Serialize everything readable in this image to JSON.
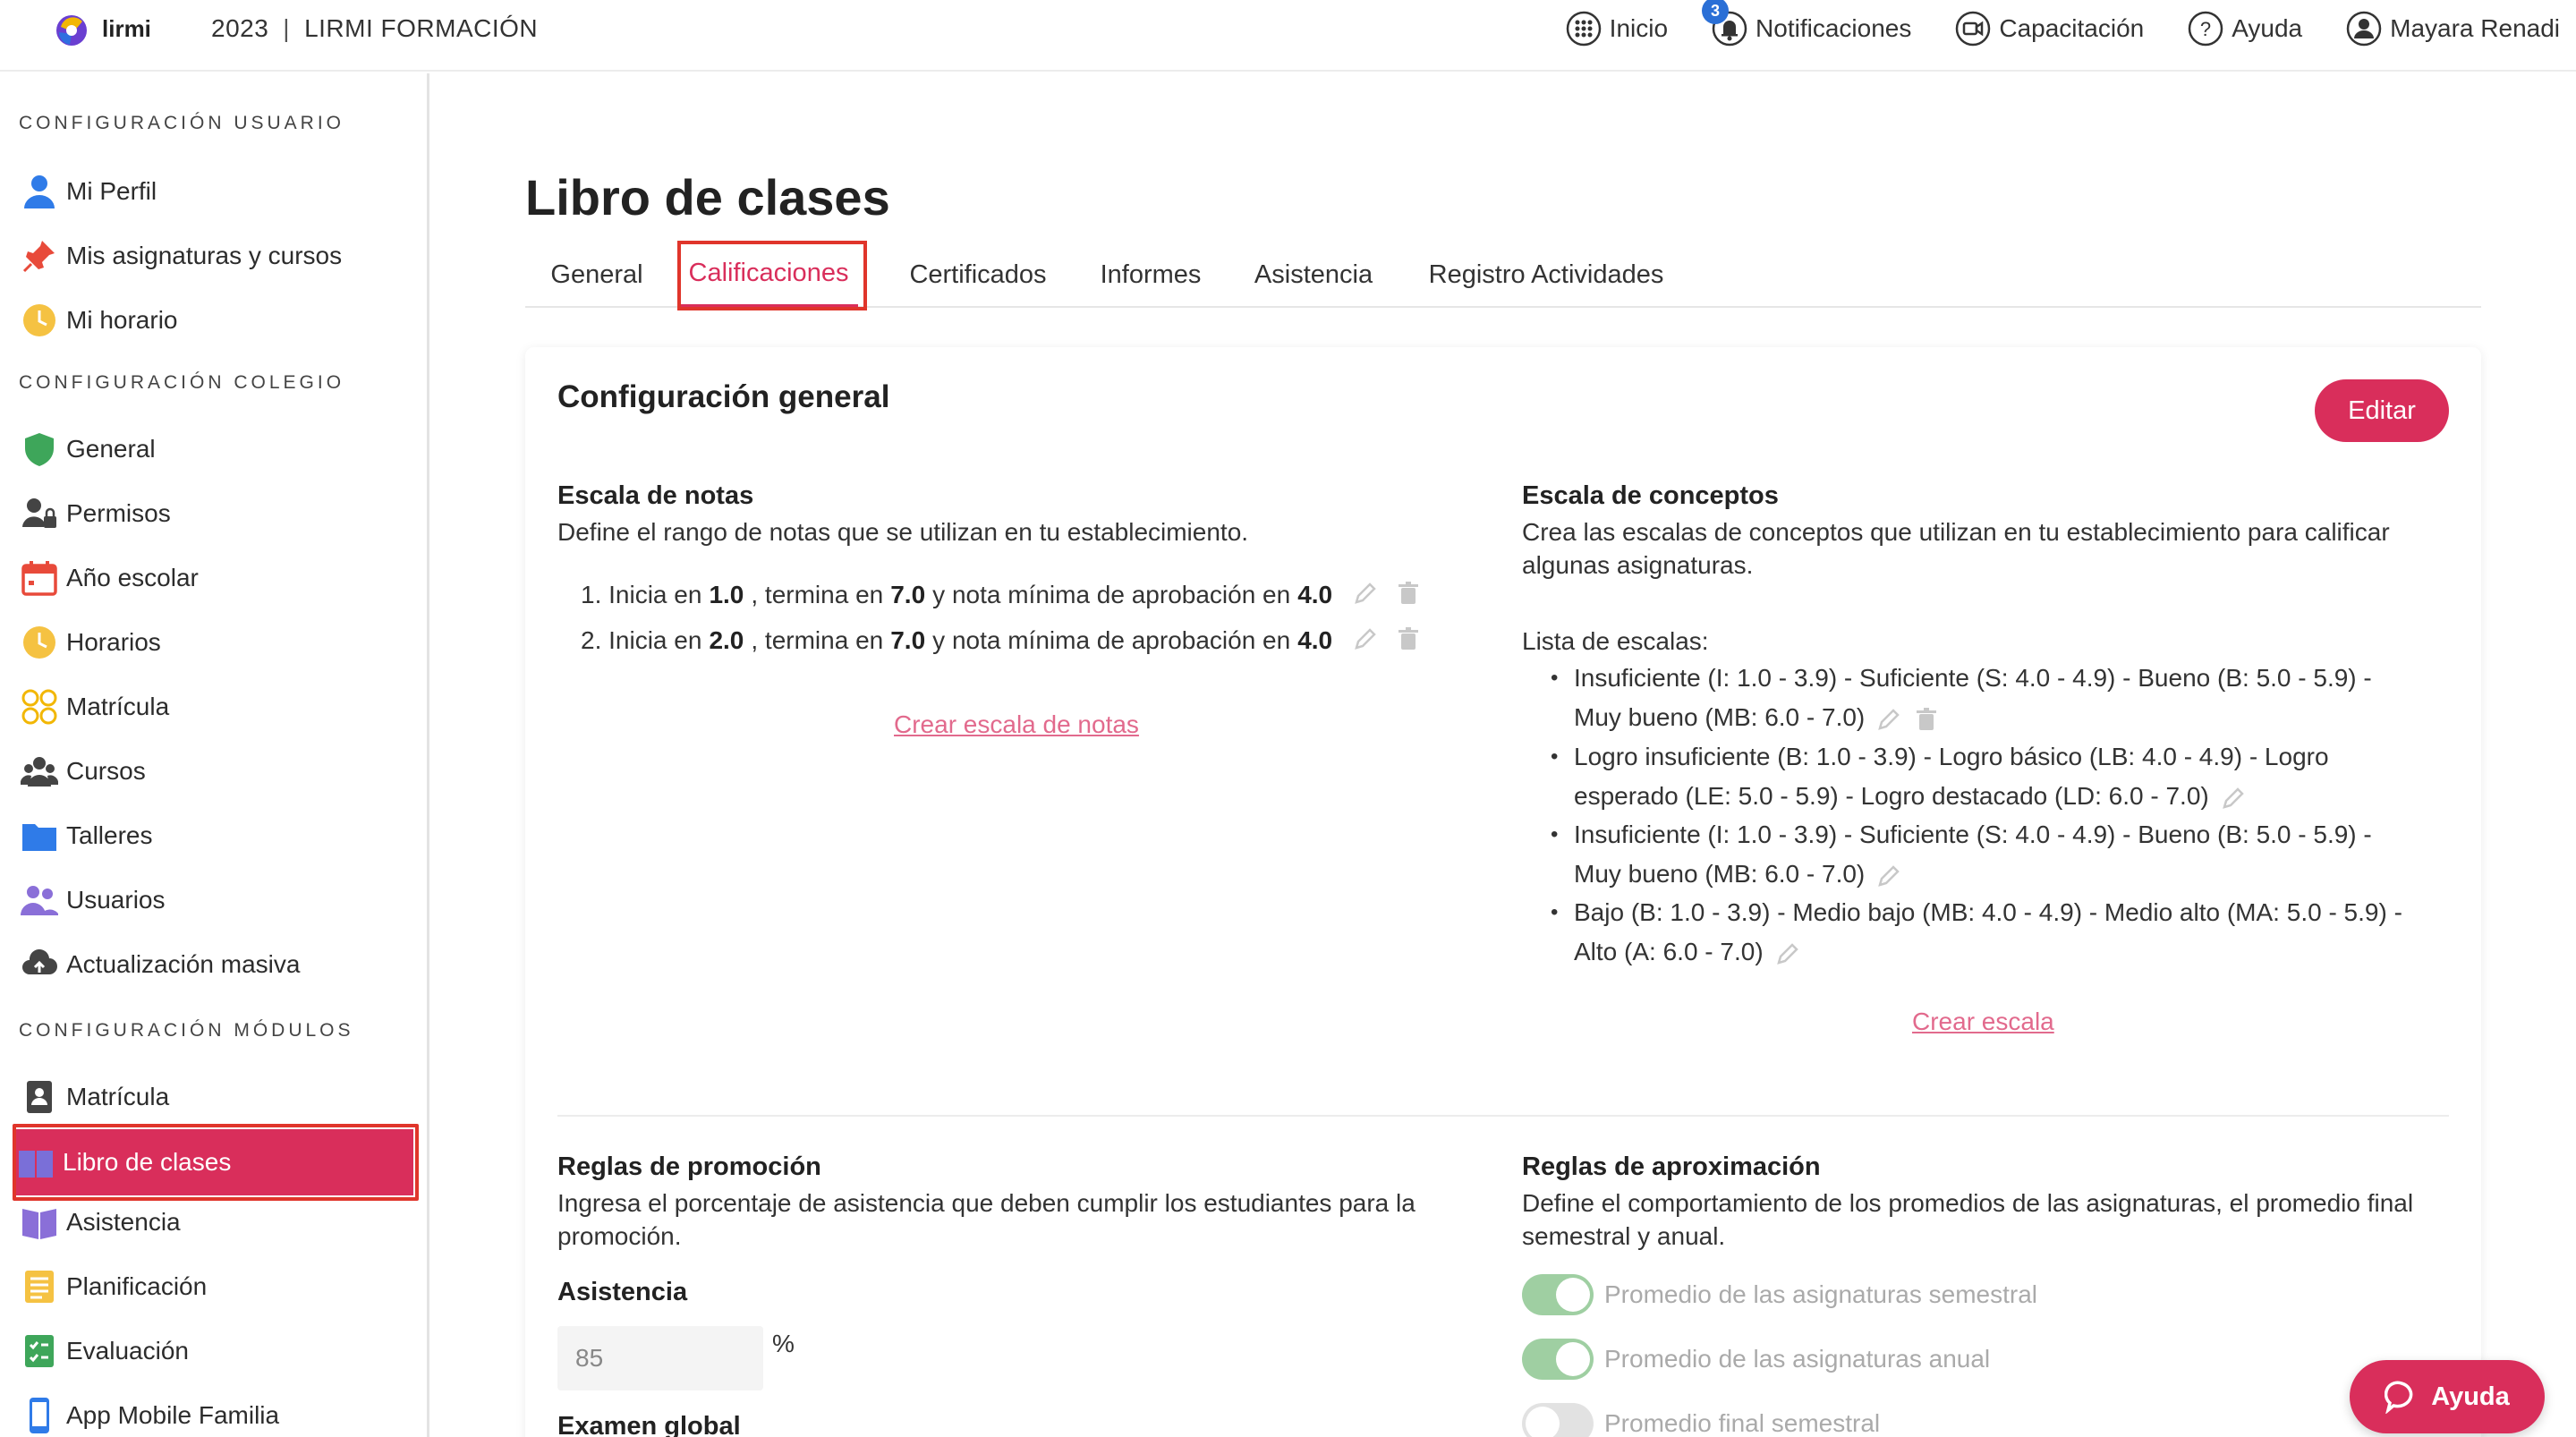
{
  "brand": {
    "logo_text": "lirmi",
    "year": "2023",
    "separator": "|",
    "org": "LIRMI FORMACIÓN"
  },
  "topnav": {
    "inicio": "Inicio",
    "notificaciones": "Notificaciones",
    "notif_count": "3",
    "capacitacion": "Capacitación",
    "ayuda": "Ayuda",
    "user": "Mayara Renadi"
  },
  "sidebar": {
    "sections": [
      "CONFIGURACIÓN USUARIO",
      "CONFIGURACIÓN COLEGIO",
      "CONFIGURACIÓN MÓDULOS"
    ],
    "usuario": [
      "Mi Perfil",
      "Mis asignaturas y cursos",
      "Mi horario"
    ],
    "colegio": [
      "General",
      "Permisos",
      "Año escolar",
      "Horarios",
      "Matrícula",
      "Cursos",
      "Talleres",
      "Usuarios",
      "Actualización masiva"
    ],
    "modulos": [
      "Matrícula",
      "Libro de clases",
      "Asistencia",
      "Planificación",
      "Evaluación",
      "App Mobile Familia"
    ],
    "active": "Libro de clases"
  },
  "page": {
    "title": "Libro de clases",
    "tabs": [
      "General",
      "Calificaciones",
      "Certificados",
      "Informes",
      "Asistencia",
      "Registro Actividades"
    ],
    "active_tab": "Calificaciones"
  },
  "card": {
    "title": "Configuración general",
    "edit_label": "Editar",
    "escala_notas": {
      "heading": "Escala de notas",
      "desc": "Define el rango de notas que se utilizan en tu establecimiento.",
      "items": [
        {
          "num": "1.",
          "start": "1.0",
          "end": "7.0",
          "min": "4.0"
        },
        {
          "num": "2.",
          "start": "2.0",
          "end": "7.0",
          "min": "4.0"
        }
      ],
      "txt_inicia": "Inicia en",
      "txt_termina": ", termina en",
      "txt_min": "y nota mínima de aprobación en",
      "create_link": "Crear escala de notas"
    },
    "escala_conceptos": {
      "heading": "Escala de conceptos",
      "desc": "Crea las escalas de conceptos que utilizan en tu establecimiento para calificar algunas asignaturas.",
      "list_label": "Lista de escalas:",
      "items": [
        {
          "line1": "Insuficiente (I: 1.0 - 3.9) - Suficiente (S: 4.0 - 4.9) - Bueno (B: 5.0 - 5.9) -",
          "line2": "Muy bueno (MB: 6.0 - 7.0)"
        },
        {
          "line1": "Logro insuficiente (B: 1.0 - 3.9) - Logro básico (LB: 4.0 - 4.9) - Logro",
          "line2": "esperado (LE: 5.0 - 5.9) - Logro destacado (LD: 6.0 - 7.0)"
        },
        {
          "line1": "Insuficiente (I: 1.0 - 3.9) - Suficiente (S: 4.0 - 4.9) - Bueno (B: 5.0 - 5.9) -",
          "line2": "Muy bueno (MB: 6.0 - 7.0)"
        },
        {
          "line1": "Bajo (B: 1.0 - 3.9) - Medio bajo (MB: 4.0 - 4.9) - Medio alto (MA: 5.0 - 5.9) -",
          "line2": "Alto (A: 6.0 - 7.0)"
        }
      ],
      "create_link": "Crear escala"
    },
    "promocion": {
      "heading": "Reglas de promoción",
      "desc": "Ingresa el porcentaje de asistencia que deben cumplir los estudiantes para la promoción.",
      "asistencia_label": "Asistencia",
      "asistencia_value": "85",
      "unit": "%",
      "examen_label": "Examen global"
    },
    "aproximacion": {
      "heading": "Reglas de aproximación",
      "desc": "Define el comportamiento de los promedios de las asignaturas, el promedio final semestral y anual.",
      "toggles": [
        {
          "label": "Promedio de las asignaturas semestral",
          "on": true
        },
        {
          "label": "Promedio de las asignaturas anual",
          "on": true
        },
        {
          "label": "Promedio final semestral",
          "on": false
        }
      ]
    }
  },
  "fab": {
    "label": "Ayuda"
  },
  "colors": {
    "accent": "#d92e5b",
    "highlight": "#e0352b",
    "link": "#e26a8d",
    "toggle_on": "#7fbf84"
  }
}
